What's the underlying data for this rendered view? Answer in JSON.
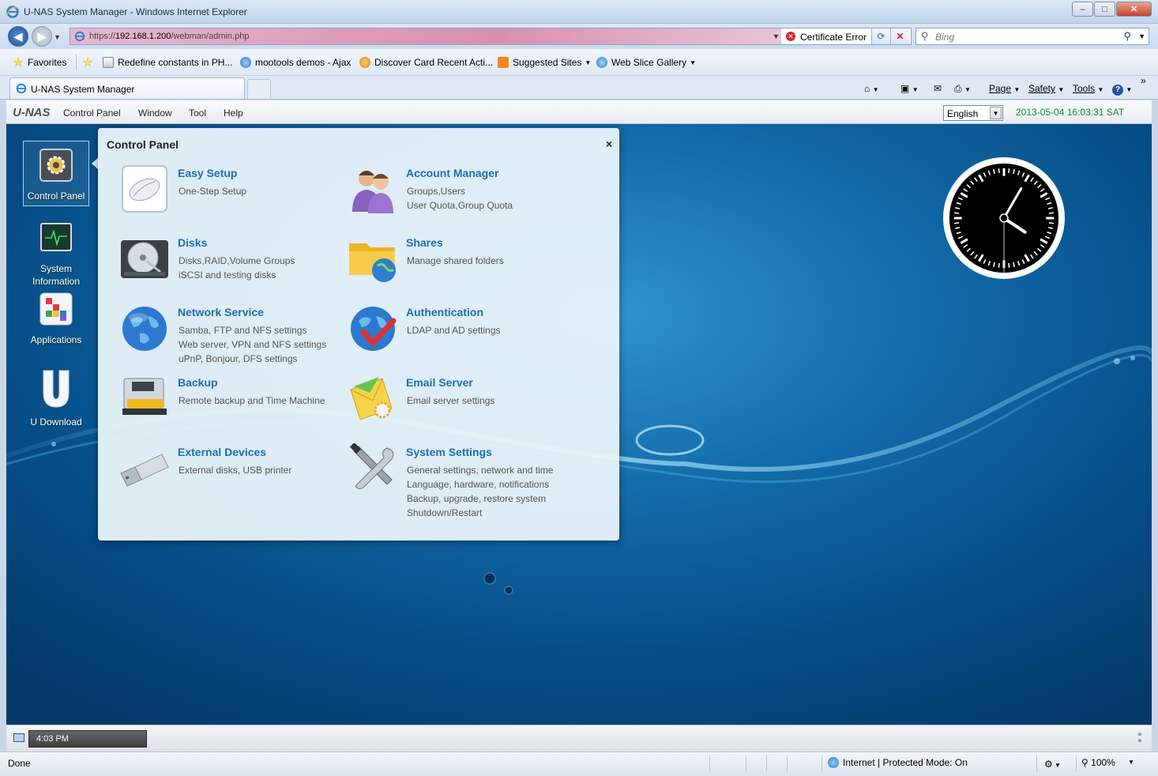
{
  "window": {
    "title": "U-NAS System Manager - Windows Internet Explorer",
    "minimize": "–",
    "maximize": "□",
    "close": "✕"
  },
  "address": {
    "url_prefix": "https://",
    "url_host": "192.168.1.200",
    "url_path": "/webman/admin.php",
    "cert_label": "Certificate Error",
    "search_placeholder": "Bing"
  },
  "favorites": {
    "favorites_label": "Favorites",
    "items": [
      {
        "label": "Redefine constants in PH..."
      },
      {
        "label": "mootools demos - Ajax"
      },
      {
        "label": "Discover Card Recent Acti..."
      },
      {
        "label": "Suggested Sites"
      },
      {
        "label": "Web Slice Gallery"
      }
    ]
  },
  "tabs": {
    "active_label": "U-NAS System Manager"
  },
  "commandbar": {
    "page": "Page",
    "safety": "Safety",
    "tools": "Tools",
    "more": "»"
  },
  "app": {
    "logo": "U-NAS",
    "menu": [
      "Control Panel",
      "Window",
      "Tool",
      "Help"
    ],
    "language": "English",
    "datetime": "2013-05-04 16:03:31 SAT"
  },
  "desktop_icons": [
    {
      "label": "Control Panel",
      "icon": "gear-icon"
    },
    {
      "label": "System Information",
      "icon": "monitor-icon"
    },
    {
      "label": "Applications",
      "icon": "apps-icon"
    },
    {
      "label": "U Download",
      "icon": "u-download-icon"
    }
  ],
  "control_panel": {
    "title": "Control Panel",
    "close": "×",
    "items": [
      {
        "name": "Easy Setup",
        "desc": [
          "One-Step Setup"
        ],
        "icon": "mouse-icon"
      },
      {
        "name": "Account Manager",
        "desc": [
          "Groups,Users",
          "User Quota,Group Quota"
        ],
        "icon": "users-icon"
      },
      {
        "name": "Disks",
        "desc": [
          "Disks,RAID,Volume Groups",
          "iSCSI and testing disks"
        ],
        "icon": "hard-disk-icon"
      },
      {
        "name": "Shares",
        "desc": [
          "Manage shared folders"
        ],
        "icon": "shared-folder-icon"
      },
      {
        "name": "Network Service",
        "desc": [
          "Samba, FTP and NFS settings",
          "Web server, VPN and NFS settings",
          "uPnP, Bonjour, DFS settings"
        ],
        "icon": "globe-icon"
      },
      {
        "name": "Authentication",
        "desc": [
          "LDAP and AD settings"
        ],
        "icon": "globe-check-icon"
      },
      {
        "name": "Backup",
        "desc": [
          "Remote backup and Time Machine"
        ],
        "icon": "backup-drive-icon"
      },
      {
        "name": "Email Server",
        "desc": [
          "Email server settings"
        ],
        "icon": "email-gear-icon"
      },
      {
        "name": "External Devices",
        "desc": [
          "External disks, USB printer"
        ],
        "icon": "usb-drive-icon"
      },
      {
        "name": "System Settings",
        "desc": [
          "General settings, network and time",
          "Language, hardware, notifications",
          "Backup, upgrade, restore system",
          "Shutdown/Restart"
        ],
        "icon": "tools-icon"
      }
    ]
  },
  "taskbar": {
    "time": "4:03 PM"
  },
  "status": {
    "text": "Done",
    "zone": "Internet | Protected Mode: On",
    "zoom": "100%"
  },
  "colors": {
    "link_blue": "#1b6fb5",
    "clock_green": "#1b8f2a",
    "desktop_blue": "#0b5c99"
  }
}
